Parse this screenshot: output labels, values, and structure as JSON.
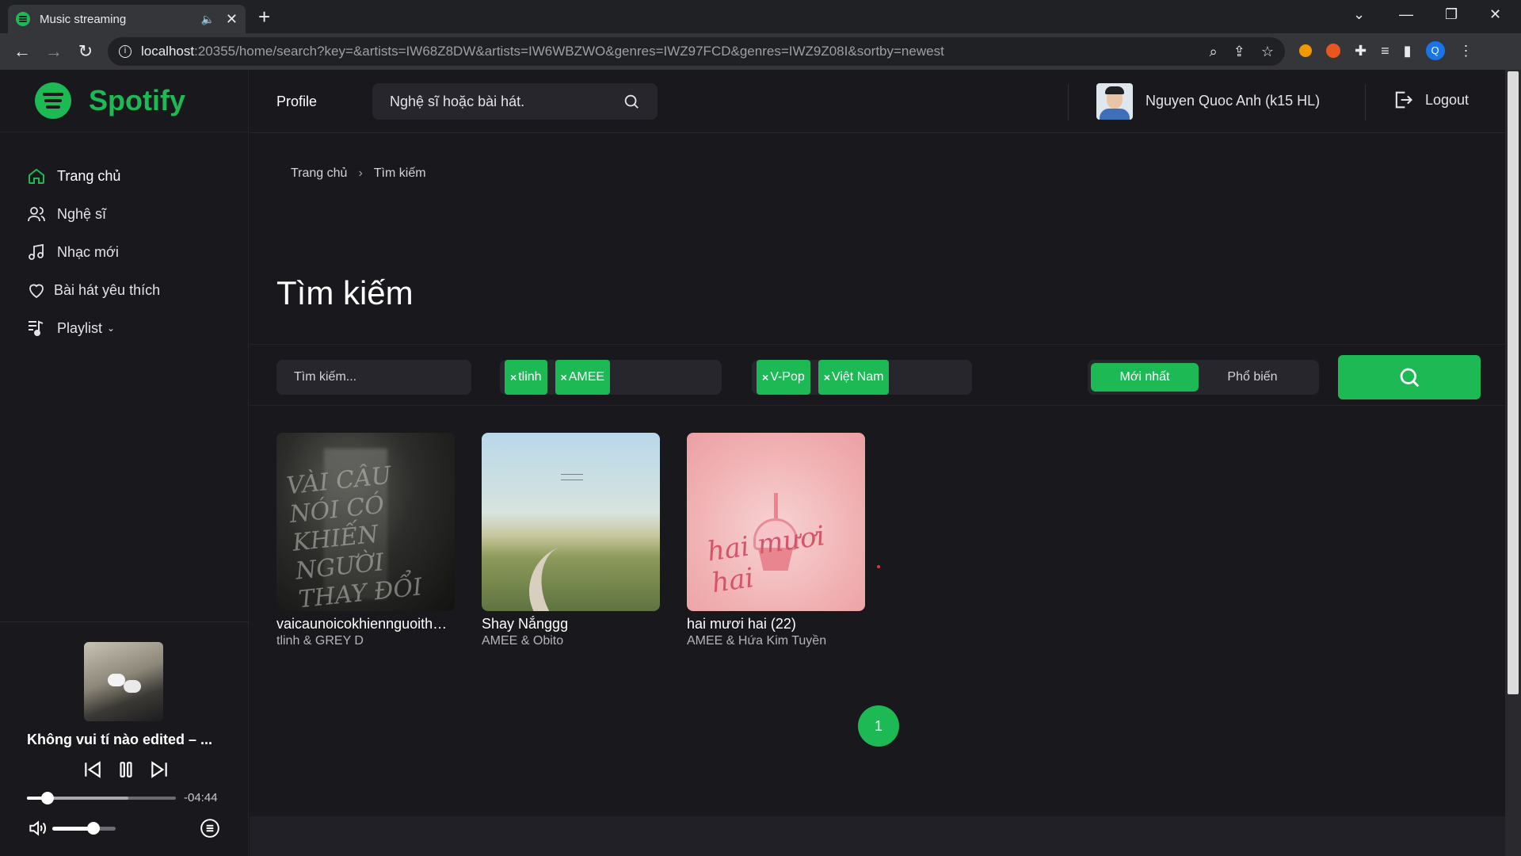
{
  "browser": {
    "tab_title": "Music streaming",
    "new_tab": "+",
    "url_host": "localhost",
    "url_rest": ":20355/home/search?key=&artists=IW68Z8DW&artists=IW6WBZWO&genres=IWZ97FCD&genres=IWZ9Z08I&sortby=newest",
    "profile_initial": "Q"
  },
  "app": {
    "brand": "Spotify",
    "brand_color": "#1db954",
    "nav": [
      {
        "label": "Trang chủ",
        "icon": "home-icon"
      },
      {
        "label": "Nghệ sĩ",
        "icon": "users-icon"
      },
      {
        "label": "Nhạc mới",
        "icon": "music-note-icon"
      },
      {
        "label": "Bài hát yêu thích",
        "icon": "heart-icon"
      },
      {
        "label": "Playlist",
        "icon": "playlist-icon",
        "caret": "⌄"
      }
    ]
  },
  "header": {
    "profile_link": "Profile",
    "search_placeholder": "Nghệ sĩ hoặc bài hát.",
    "username": "Nguyen Quoc Anh (k15 HL)",
    "logout": "Logout"
  },
  "breadcrumb": {
    "home": "Trang chủ",
    "separator": "›",
    "current": "Tìm kiếm"
  },
  "page": {
    "title": "Tìm kiếm"
  },
  "filters": {
    "keyword_placeholder": "Tìm kiếm...",
    "artists": [
      "tlinh",
      "AMEE"
    ],
    "genres": [
      "V-Pop",
      "Việt Nam"
    ],
    "tag_remove": "×",
    "sort": {
      "options": [
        "Mới nhất",
        "Phổ biến"
      ],
      "selected": "Mới nhất"
    }
  },
  "results": [
    {
      "title": "vaicaunoicokhiennguoithayđoi",
      "artists": "tlinh & GREY D",
      "art_text": "VÀI CÂU NÓI CÓ KHIẾN NGƯỜI THAY ĐỔI"
    },
    {
      "title": "Shay Nắnggg",
      "artists": "AMEE & Obito"
    },
    {
      "title": "hai mươi hai (22)",
      "artists": "AMEE & Hứa Kim Tuyền",
      "art_text": "hai mươi hai"
    }
  ],
  "pagination": {
    "current": "1"
  },
  "player": {
    "title": "Không vui tí nào edited – ...",
    "remaining": "-04:44",
    "progress": 0.14,
    "buffered": 0.68,
    "volume": 0.65
  }
}
